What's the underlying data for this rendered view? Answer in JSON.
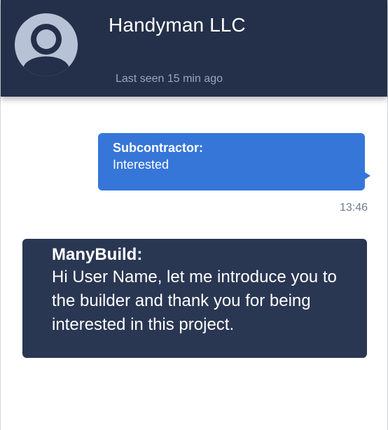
{
  "header": {
    "contact_name": "Handyman LLC",
    "last_seen": "Last seen 15 min ago",
    "avatar_icon": "user-avatar-icon"
  },
  "messages": [
    {
      "sender": "Subcontractor:",
      "text": "Interested",
      "direction": "outgoing",
      "time": "13:46"
    },
    {
      "sender": "ManyBuild:",
      "text": "Hi User Name, let me introduce you to the builder and thank you for being interested in this project.",
      "direction": "incoming"
    }
  ],
  "colors": {
    "header_bg": "#243049",
    "outgoing_bubble": "#3676d8",
    "incoming_bubble": "#2a3753",
    "avatar_bg": "#b8c2d6"
  }
}
